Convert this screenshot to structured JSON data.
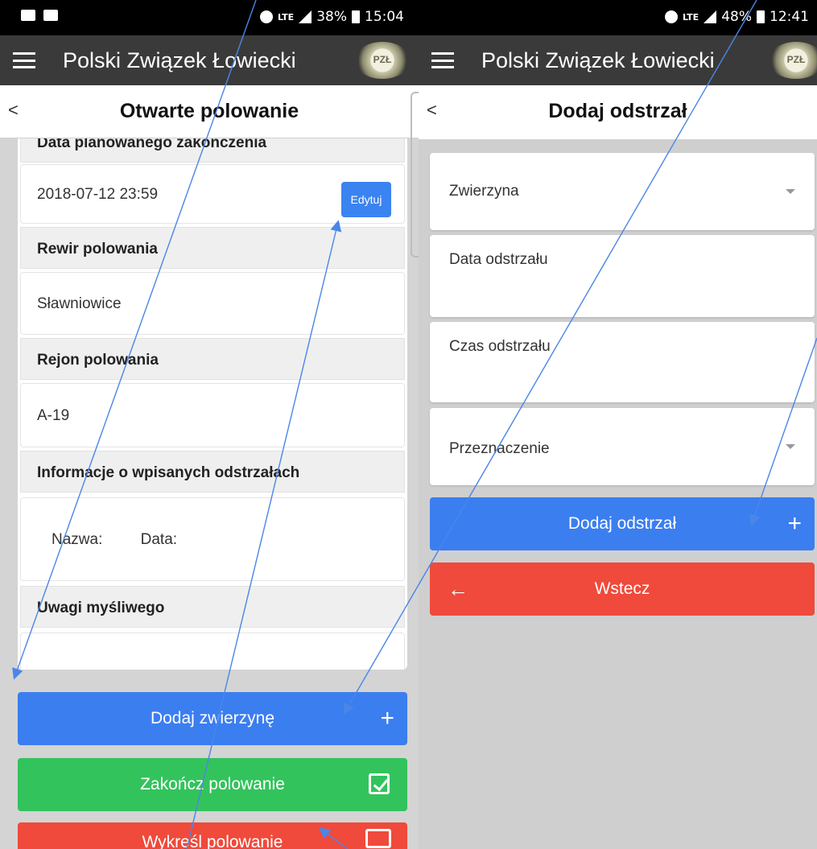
{
  "left_screen": {
    "status": {
      "battery": "38%",
      "time": "15:04",
      "network": "LTE"
    },
    "app_title": "Polski Związek Łowiecki",
    "logo_text": "PZŁ",
    "page_title": "Otwarte polowanie",
    "partial_label": "Data planowanego zakończenia",
    "end_date_value": "2018-07-12 23:59",
    "edit_label": "Edytuj",
    "rows": [
      {
        "label": "Rewir polowania",
        "value": "Sławniowice"
      },
      {
        "label": "Rejon polowania",
        "value": "A-19"
      },
      {
        "label": "Informacje o wpisanych odstrzałach",
        "col_name": "Nazwa:",
        "col_date": "Data:"
      },
      {
        "label": "Uwagi myśliwego",
        "value": ""
      }
    ],
    "buttons": {
      "add_animal": "Dodaj zwierzynę",
      "finish": "Zakończ polowanie",
      "cancel": "Wykreśl polowanie"
    },
    "colors": {
      "blue": "#3b7ef0",
      "green": "#33c35c",
      "red": "#ef4a3b"
    }
  },
  "right_screen": {
    "status": {
      "battery": "48%",
      "time": "12:41",
      "network": "LTE"
    },
    "app_title": "Polski Związek Łowiecki",
    "logo_text": "PZŁ",
    "page_title": "Dodaj odstrzał",
    "fields": {
      "game": "Zwierzyna",
      "date": "Data odstrzału",
      "time": "Czas odstrzału",
      "purpose": "Przeznaczenie"
    },
    "buttons": {
      "add": "Dodaj odstrzał",
      "back": "Wstecz"
    }
  },
  "icons": [
    "hamburger-icon",
    "chevron-left-icon",
    "plus-icon",
    "checkbox-icon",
    "backspace-icon",
    "arrow-left-icon",
    "caret-down-icon"
  ]
}
